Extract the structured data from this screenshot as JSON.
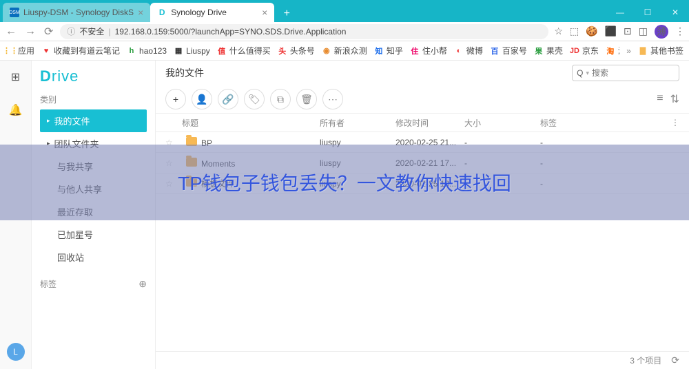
{
  "browser": {
    "tabs": [
      {
        "title": "Liuspy-DSM - Synology DiskS",
        "active": false,
        "favicon": "DSM"
      },
      {
        "title": "Synology Drive",
        "active": true,
        "favicon": "D"
      }
    ],
    "url_prefix": "不安全",
    "url": "192.168.0.159:5000/?launchApp=SYNO.SDS.Drive.Application",
    "bookmarks": [
      {
        "label": "应用",
        "icon": "⋮⋮",
        "color": "#f2b01e"
      },
      {
        "label": "收藏到有道云笔记",
        "icon": "♥",
        "color": "#e33"
      },
      {
        "label": "hao123",
        "icon": "h",
        "color": "#2a9d3f"
      },
      {
        "label": "Liuspy",
        "icon": "▦",
        "color": "#333"
      },
      {
        "label": "什么值得买",
        "icon": "值",
        "color": "#e33"
      },
      {
        "label": "头条号",
        "icon": "头",
        "color": "#e33"
      },
      {
        "label": "新浪众测",
        "icon": "◉",
        "color": "#e88c30"
      },
      {
        "label": "知乎",
        "icon": "知",
        "color": "#1f6feb"
      },
      {
        "label": "住小帮",
        "icon": "住",
        "color": "#e06"
      },
      {
        "label": "微博",
        "icon": "◐",
        "color": "#e33"
      },
      {
        "label": "百家号",
        "icon": "百",
        "color": "#2a64e8"
      },
      {
        "label": "果壳",
        "icon": "果",
        "color": "#2a9d3f"
      },
      {
        "label": "京东",
        "icon": "JD",
        "color": "#e33"
      },
      {
        "label": "淘记",
        "icon": "淘",
        "color": "#f60"
      }
    ],
    "bookmarks_other": "其他书签"
  },
  "app": {
    "logo": "Drive",
    "sidebar": {
      "category_label": "类别",
      "items": [
        {
          "label": "我的文件",
          "active": true,
          "arrow": true
        },
        {
          "label": "团队文件夹",
          "active": false,
          "arrow": true
        },
        {
          "label": "与我共享",
          "active": false
        },
        {
          "label": "与他人共享",
          "active": false
        },
        {
          "label": "最近存取",
          "active": false
        },
        {
          "label": "已加星号",
          "active": false
        },
        {
          "label": "回收站",
          "active": false
        }
      ],
      "tags_label": "标签"
    },
    "header": {
      "title": "我的文件",
      "search_placeholder": "搜索"
    },
    "columns": {
      "name": "标题",
      "owner": "所有者",
      "modified": "修改时间",
      "size": "大小",
      "tags": "标签"
    },
    "rows": [
      {
        "name": "BP",
        "owner": "liuspy",
        "modified": "2020-02-25 21...",
        "size": "-",
        "tags": "-"
      },
      {
        "name": "Moments",
        "owner": "liuspy",
        "modified": "2020-02-21 17...",
        "size": "-",
        "tags": "-"
      },
      {
        "name": "模板文件",
        "owner": "liuspy",
        "modified": "2020-02-25 13...",
        "size": "-",
        "tags": "-"
      }
    ],
    "status": {
      "count": "3 个项目"
    },
    "rail_avatar": "L"
  },
  "overlay_text": "TP钱包子钱包丢失？一文教你快速找回"
}
